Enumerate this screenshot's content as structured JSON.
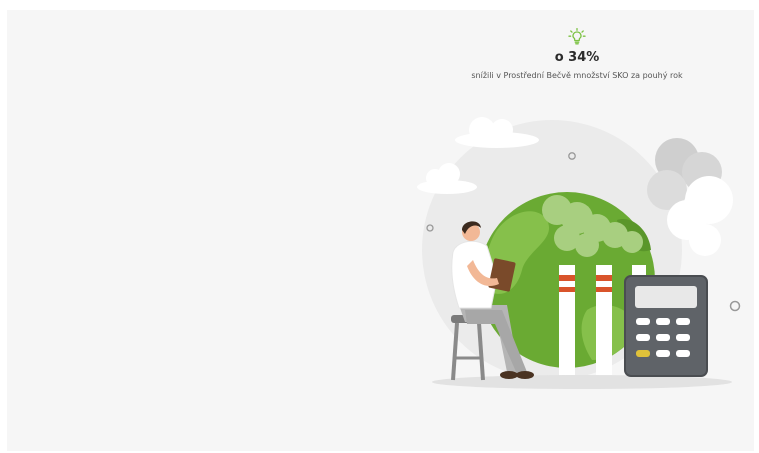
{
  "stat": {
    "icon": "lightbulb-icon",
    "value": "o 34%",
    "caption": "snížili v Prostřední Bečvě množství SKO za pouhý rok"
  },
  "colors": {
    "accent": "#7cc243",
    "globe": "#6aaa33",
    "background": "#f6f6f6"
  }
}
